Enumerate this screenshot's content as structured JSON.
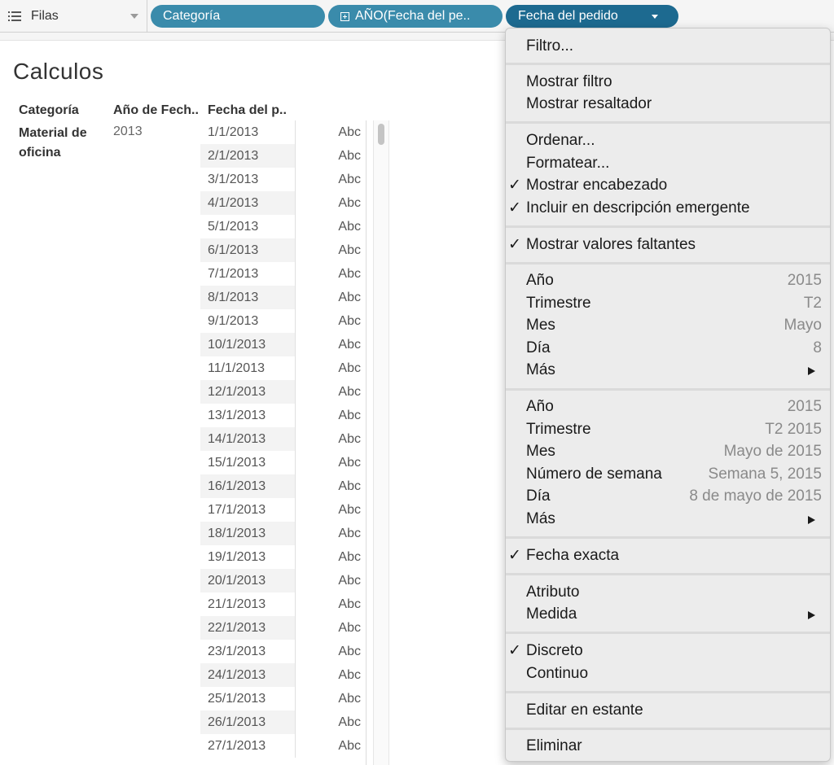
{
  "shelf": {
    "label": "Filas",
    "pills": [
      {
        "label": "Categoría"
      },
      {
        "label": "AÑO(Fecha del pe.."
      },
      {
        "label": "Fecha del pedido"
      }
    ]
  },
  "sheet": {
    "title": "Calculos",
    "headers": [
      "Categoría",
      "Año de Fech..",
      "Fecha del p.."
    ],
    "category": "Material de oficina",
    "year": "2013",
    "rows": [
      {
        "date": "1/1/2013",
        "value": "Abc"
      },
      {
        "date": "2/1/2013",
        "value": "Abc"
      },
      {
        "date": "3/1/2013",
        "value": "Abc"
      },
      {
        "date": "4/1/2013",
        "value": "Abc"
      },
      {
        "date": "5/1/2013",
        "value": "Abc"
      },
      {
        "date": "6/1/2013",
        "value": "Abc"
      },
      {
        "date": "7/1/2013",
        "value": "Abc"
      },
      {
        "date": "8/1/2013",
        "value": "Abc"
      },
      {
        "date": "9/1/2013",
        "value": "Abc"
      },
      {
        "date": "10/1/2013",
        "value": "Abc"
      },
      {
        "date": "11/1/2013",
        "value": "Abc"
      },
      {
        "date": "12/1/2013",
        "value": "Abc"
      },
      {
        "date": "13/1/2013",
        "value": "Abc"
      },
      {
        "date": "14/1/2013",
        "value": "Abc"
      },
      {
        "date": "15/1/2013",
        "value": "Abc"
      },
      {
        "date": "16/1/2013",
        "value": "Abc"
      },
      {
        "date": "17/1/2013",
        "value": "Abc"
      },
      {
        "date": "18/1/2013",
        "value": "Abc"
      },
      {
        "date": "19/1/2013",
        "value": "Abc"
      },
      {
        "date": "20/1/2013",
        "value": "Abc"
      },
      {
        "date": "21/1/2013",
        "value": "Abc"
      },
      {
        "date": "22/1/2013",
        "value": "Abc"
      },
      {
        "date": "23/1/2013",
        "value": "Abc"
      },
      {
        "date": "24/1/2013",
        "value": "Abc"
      },
      {
        "date": "25/1/2013",
        "value": "Abc"
      },
      {
        "date": "26/1/2013",
        "value": "Abc"
      },
      {
        "date": "27/1/2013",
        "value": "Abc"
      }
    ]
  },
  "menu": {
    "filter": "Filtro...",
    "show_filter": "Mostrar filtro",
    "show_highlighter": "Mostrar resaltador",
    "sort": "Ordenar...",
    "format": "Formatear...",
    "show_header": "Mostrar encabezado",
    "include_tooltip": "Incluir en descripción emergente",
    "show_missing": "Mostrar valores faltantes",
    "discrete_parts": [
      {
        "label": "Año",
        "value": "2015"
      },
      {
        "label": "Trimestre",
        "value": "T2"
      },
      {
        "label": "Mes",
        "value": "Mayo"
      },
      {
        "label": "Día",
        "value": "8"
      },
      {
        "label": "Más",
        "value": ""
      }
    ],
    "continuous_parts": [
      {
        "label": "Año",
        "value": "2015"
      },
      {
        "label": "Trimestre",
        "value": "T2 2015"
      },
      {
        "label": "Mes",
        "value": "Mayo de 2015"
      },
      {
        "label": "Número de semana",
        "value": "Semana 5, 2015"
      },
      {
        "label": "Día",
        "value": "8 de mayo de 2015"
      },
      {
        "label": "Más",
        "value": ""
      }
    ],
    "exact_date": "Fecha exacta",
    "attribute": "Atributo",
    "measure": "Medida",
    "discrete": "Discreto",
    "continuous": "Continuo",
    "edit_in_shelf": "Editar en estante",
    "remove": "Eliminar",
    "checkmark": "✓"
  }
}
